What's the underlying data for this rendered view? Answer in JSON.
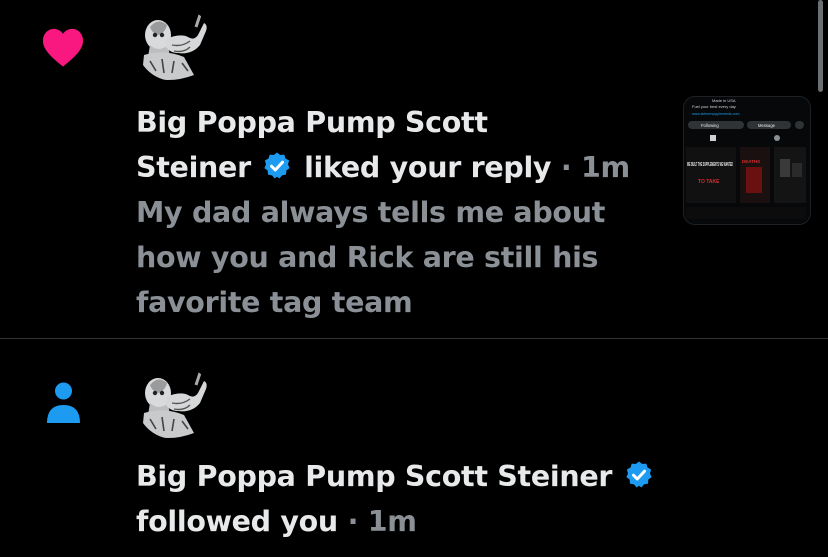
{
  "notifications": [
    {
      "type": "like",
      "icon": "heart-icon",
      "icon_color": "#f91880",
      "name_line1": "Big Poppa Pump Scott",
      "name_line2": "Steiner",
      "action": "liked your reply",
      "separator": "·",
      "time": "1m",
      "reply_lines": [
        "My dad always tells me about",
        "how you and Rick are still his",
        "favorite tag team"
      ],
      "thumbnail": {
        "lines": [
          "Made in USA",
          "Fuel your best every day",
          "www.steinersupplements.com"
        ],
        "following_label": "Following",
        "message_label": "Message",
        "promo_text": "WE BUILT THE SUPPLEMENTS WE WANTED",
        "promo_sub": "TO TAKE",
        "side_text": "DEATHS"
      }
    },
    {
      "type": "follow",
      "icon": "person-icon",
      "icon_color": "#1d9bf0",
      "name": "Big Poppa Pump Scott Steiner",
      "action": "followed you",
      "separator": "·",
      "time": "1m"
    }
  ],
  "colors": {
    "background": "#000000",
    "primary_text": "#e7e9ea",
    "secondary_text": "#8b9096",
    "verified": "#1d9bf0",
    "like": "#f91880",
    "divider": "#2f3336"
  }
}
